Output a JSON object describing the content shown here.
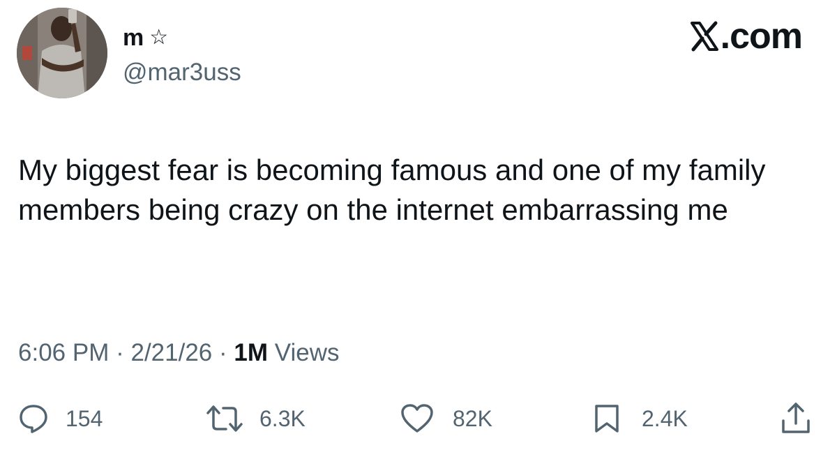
{
  "user": {
    "display_name": "m",
    "badge_icon": "star-outline-icon",
    "handle": "@mar3uss"
  },
  "brand": {
    "label": ".com",
    "logo_icon": "x-logo-icon"
  },
  "tweet": {
    "text": "My biggest fear is becoming famous and one of my family members being crazy on the internet embarrassing me",
    "time": "6:06 PM",
    "separator": "·",
    "date": "2/21/26",
    "views_count": "1M",
    "views_label": "Views"
  },
  "actions": {
    "replies": {
      "icon": "reply-icon",
      "count": "154"
    },
    "reposts": {
      "icon": "repost-icon",
      "count": "6.3K"
    },
    "likes": {
      "icon": "heart-icon",
      "count": "82K"
    },
    "bookmarks": {
      "icon": "bookmark-icon",
      "count": "2.4K"
    },
    "share": {
      "icon": "share-icon"
    }
  },
  "colors": {
    "text_primary": "#0f1419",
    "text_secondary": "#536471",
    "background": "#ffffff"
  }
}
